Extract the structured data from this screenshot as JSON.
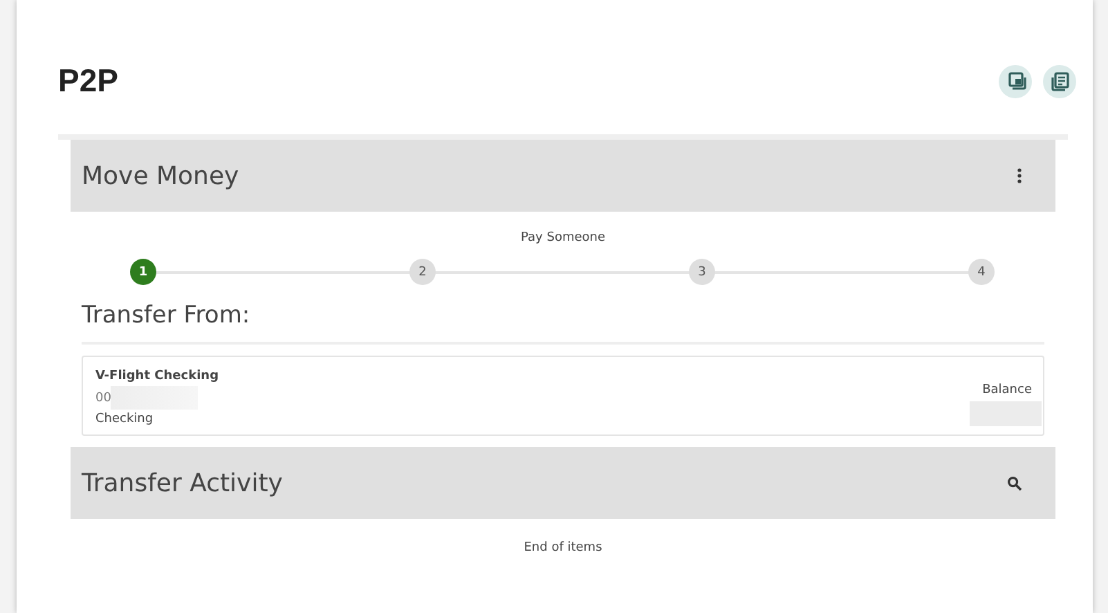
{
  "page": {
    "title": "P2P"
  },
  "toolbar": [
    {
      "kind": "window"
    },
    {
      "kind": "document"
    }
  ],
  "move_money": {
    "title": "Move Money",
    "stepper": {
      "label": "Pay Someone",
      "steps": [
        {
          "label": "1",
          "selected": true
        },
        {
          "label": "2",
          "selected": false
        },
        {
          "label": "3",
          "selected": false
        },
        {
          "label": "4",
          "selected": false
        }
      ]
    },
    "transfer_from": {
      "title": "Transfer From:",
      "account": {
        "name": "V-Flight Checking",
        "number": "00",
        "type": "Checking",
        "balance_label": "Balance"
      }
    }
  },
  "transfer_activity": {
    "title": "Transfer Activity",
    "footer": "End of items"
  }
}
